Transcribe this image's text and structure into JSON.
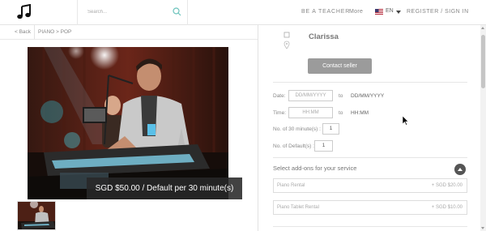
{
  "header": {
    "search_placeholder": "Search...",
    "nav": {
      "be_teacher": "BE A TEACHER",
      "more": "More",
      "register": "REGISTER / SIGN IN"
    },
    "language": {
      "code": "EN",
      "flag_icon": "us-flag-icon"
    }
  },
  "breadcrumb": {
    "back": "< Back",
    "path": "PIANO > POP"
  },
  "listing": {
    "price_banner": "SGD $50.00 / Default per 30 minute(s)",
    "image_alt": "Musician playing keyboards on stage",
    "thumbnail_alt": "Thumbnail of performer on stage"
  },
  "seller": {
    "name": "Clarissa",
    "contact_label": "Contact seller"
  },
  "booking": {
    "date_label": "Date:",
    "date_placeholder": "DD/MM/YYYY",
    "to_label": "to",
    "date_end": "DD/MM/YYYY",
    "time_label": "Time:",
    "time_placeholder": "HH:MM",
    "time_end": "HH:MM",
    "slots_label": "No. of 30 minute(s) :",
    "slots_value": "1",
    "default_label": "No. of Default(s) :",
    "default_value": "1"
  },
  "addons": {
    "title": "Select add-ons for your service",
    "items": [
      {
        "name": "Piano Rental",
        "price": "+ SGD $20.00"
      },
      {
        "name": "Piano Tablet Rental",
        "price": "+ SGD $10.00"
      }
    ]
  },
  "colors": {
    "button_gray": "#9b9b9b",
    "dark_badge": "#555555",
    "accent_teal": "#4aa8a0"
  }
}
